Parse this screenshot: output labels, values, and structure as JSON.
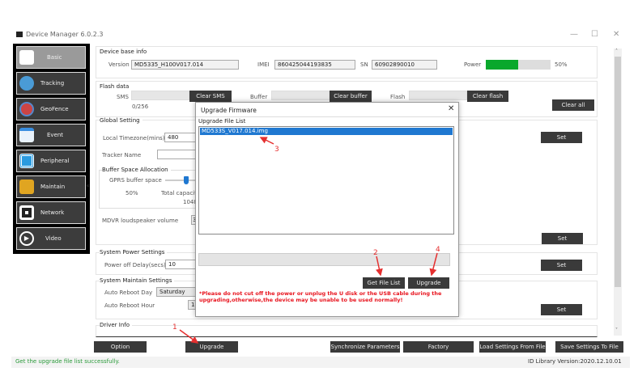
{
  "window": {
    "title": "Device Manager 6.0.2.3",
    "minimize": "—",
    "maximize": "☐",
    "close": "✕"
  },
  "sidebar": {
    "items": [
      {
        "label": "Basic",
        "icon": "basic-icon",
        "active": true
      },
      {
        "label": "Tracking",
        "icon": "tracking-icon"
      },
      {
        "label": "GeoFence",
        "icon": "geofence-icon"
      },
      {
        "label": "Event",
        "icon": "event-icon"
      },
      {
        "label": "Peripheral",
        "icon": "peripheral-icon"
      },
      {
        "label": "Maintain",
        "icon": "maintain-icon"
      },
      {
        "label": "Network",
        "icon": "network-icon"
      },
      {
        "label": "Video",
        "icon": "video-icon"
      }
    ],
    "collapse": "«"
  },
  "base": {
    "title": "Device base info",
    "version_label": "Version",
    "version": "MD5335_H100V017.014",
    "imei_label": "IMEI",
    "imei": "860425044193835",
    "sn_label": "SN",
    "sn": "60902890010",
    "power_label": "Power",
    "power_percent": 50,
    "power_text": "50%",
    "power_color": "#0aa82c"
  },
  "flash": {
    "title": "Flash data",
    "sms_label": "SMS",
    "sms_count": "0/256",
    "clear_sms": "Clear SMS",
    "buffer_label": "Buffer",
    "clear_buffer": "Clear buffer",
    "flash_label": "Flash",
    "clear_flash": "Clear flash",
    "clear_all": "Clear all"
  },
  "global": {
    "title": "Global Setting",
    "timezone_label": "Local Timezone(mins)",
    "timezone": "480",
    "tracker_label": "Tracker Name",
    "tracker": "",
    "buffer_title": "Buffer Space Allocation",
    "gprs_label": "GPRS buffer space",
    "gprs_percent": "50%",
    "total_label": "Total capacity",
    "total_value": "1048",
    "speaker_label": "MDVR loudspeaker volume",
    "speaker": "3",
    "set": "Set"
  },
  "power": {
    "title": "System Power Settings",
    "delay_label": "Power off Delay(secs)",
    "delay": "10",
    "set": "Set"
  },
  "maintain": {
    "title": "System Maintain Settings",
    "day_label": "Auto Reboot Day",
    "day": "Saturday",
    "hour_label": "Auto Reboot Hour",
    "hour": "1",
    "set": "Set"
  },
  "driver": {
    "title": "Driver Info"
  },
  "footer": {
    "option": "Option",
    "upgrade": "Upgrade",
    "sync": "Synchronize Parameters",
    "factory": "Factory",
    "load": "Load Settings From File",
    "save": "Save Settings To File"
  },
  "status": {
    "message": "Get the upgrade file list successfully.",
    "library": "ID Library Version:2020.12.10.01"
  },
  "dialog": {
    "title": "Upgrade Firmware",
    "close": "✕",
    "list_title": "Upgrade File List",
    "files": [
      "MD533S_V017.014.img"
    ],
    "get_list": "Get File List",
    "upgrade": "Upgrade",
    "warning": "*Please do not cut off the power or unplug the U disk or the USB cable during the upgrading,otherwise,the device may be unable to be used normally!",
    "warning_color": "#e8141e"
  },
  "annotations": [
    "1",
    "2",
    "3",
    "4"
  ]
}
